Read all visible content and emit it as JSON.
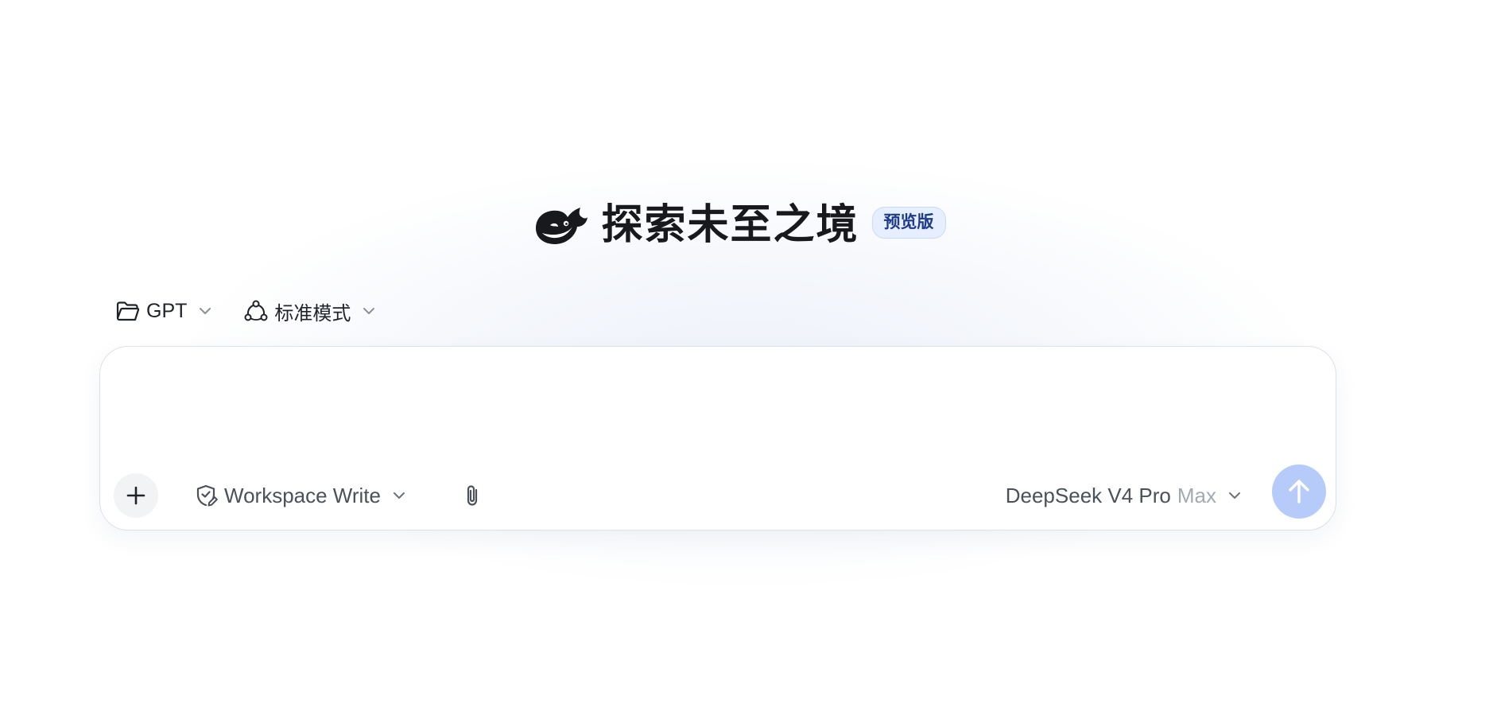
{
  "hero": {
    "title": "探索未至之境",
    "badge": "预览版",
    "logo_icon": "whale-logo-icon"
  },
  "selectors": {
    "project": {
      "label": "GPT",
      "icon": "folder-icon"
    },
    "mode": {
      "label": "标准模式",
      "icon": "nodes-icon"
    }
  },
  "composer": {
    "input_value": "",
    "input_placeholder": "",
    "plus_icon": "plus-icon",
    "permission": {
      "label": "Workspace Write",
      "icon": "shield-edit-icon"
    },
    "attach_icon": "paperclip-icon",
    "model": {
      "name": "DeepSeek V4 Pro",
      "effort": "Max"
    },
    "send_icon": "arrow-up-icon"
  },
  "colors": {
    "send_button": "#b6cbfa",
    "badge_background": "#e6efff",
    "badge_text": "#1e3a8a",
    "muted_text": "#a4a9b2"
  }
}
